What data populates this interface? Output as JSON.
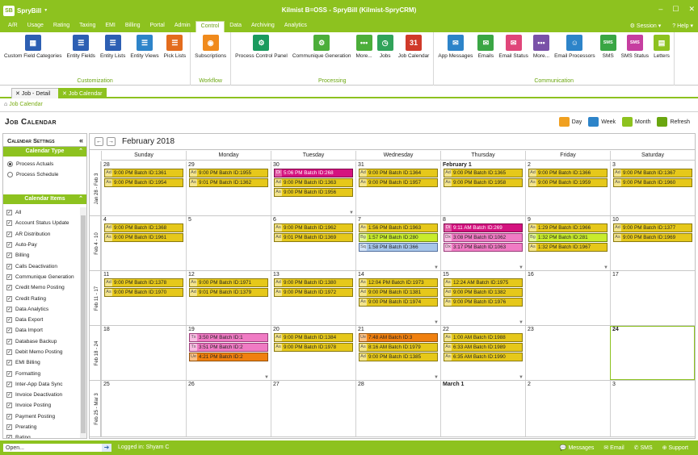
{
  "app": {
    "logo": "SpryBill",
    "logo_mark": "SB",
    "dropdown": "▼",
    "title": "Kilmist B=OSS - SpryBill (Kilmist-SpryCRM)",
    "win_min": "–",
    "win_max": "☐",
    "win_close": "✕"
  },
  "menu": {
    "items": [
      "A/R",
      "Usage",
      "Rating",
      "Taxing",
      "EMI",
      "Billing",
      "Portal",
      "Admin",
      "Control",
      "Data",
      "Archiving",
      "Analytics"
    ],
    "active": "Control",
    "session": "Session",
    "help": "Help"
  },
  "ribbon": {
    "groups": [
      {
        "label": "Customization",
        "buttons": [
          {
            "label": "Custom Field Categories",
            "icon": "grid-icon",
            "color": "#2d5fb3"
          },
          {
            "label": "Entity Fields",
            "icon": "list-icon",
            "color": "#2d5fb3"
          },
          {
            "label": "Entity Lists",
            "icon": "list-icon",
            "color": "#2d5fb3"
          },
          {
            "label": "Entity Views",
            "icon": "list-icon",
            "color": "#2d84c9"
          },
          {
            "label": "Pick Lists",
            "icon": "list-icon",
            "color": "#e36c1d"
          }
        ]
      },
      {
        "label": "Workflow",
        "buttons": [
          {
            "label": "Subscriptions",
            "icon": "rss-icon",
            "color": "#f08a1c"
          }
        ]
      },
      {
        "label": "Processing",
        "buttons": [
          {
            "label": "Process Control Panel",
            "icon": "gear-icon",
            "color": "#1a9a5e"
          },
          {
            "label": "Communique Generation",
            "icon": "gear-icon",
            "color": "#4cae3a"
          },
          {
            "label": "More...",
            "icon": "more-icon",
            "color": "#4cae3a"
          },
          {
            "label": "Jobs",
            "icon": "clock-icon",
            "color": "#31a35a"
          },
          {
            "label": "Job Calendar",
            "icon": "calendar-icon",
            "color": "#d03a2a"
          }
        ]
      },
      {
        "label": "Communication",
        "buttons": [
          {
            "label": "App Messages",
            "icon": "chat-icon",
            "color": "#2d84c9"
          },
          {
            "label": "Emails",
            "icon": "mail-icon",
            "color": "#3aa644"
          },
          {
            "label": "Email Status",
            "icon": "mail-icon",
            "color": "#e0467a"
          },
          {
            "label": "More...",
            "icon": "more-icon",
            "color": "#7a52a8"
          },
          {
            "label": "Email Processors",
            "icon": "people-icon",
            "color": "#2d84c9"
          },
          {
            "label": "SMS",
            "icon": "sms-icon",
            "color": "#3aa644"
          },
          {
            "label": "SMS Status",
            "icon": "sms-icon",
            "color": "#c63ea0"
          },
          {
            "label": "Letters",
            "icon": "doc-icon",
            "color": "#8dc21f"
          }
        ]
      }
    ]
  },
  "tabs": [
    {
      "label": "Job - Detail",
      "active": false
    },
    {
      "label": "Job Calendar",
      "active": true
    }
  ],
  "breadcrumb": "Job Calendar",
  "page_title": "Job Calendar",
  "views": [
    {
      "label": "Day",
      "color": "#f0a020"
    },
    {
      "label": "Week",
      "color": "#2d84c9"
    },
    {
      "label": "Month",
      "color": "#8dc21f"
    },
    {
      "label": "Refresh",
      "color": "#6aa60f"
    }
  ],
  "sidebar": {
    "title": "Calendar Settings",
    "type_title": "Calendar Type",
    "types": [
      {
        "label": "Process Actuals",
        "checked": true
      },
      {
        "label": "Process Schedule",
        "checked": false
      }
    ],
    "items_title": "Calendar Items",
    "items": [
      "All",
      "Account Status Update",
      "AR Distribution",
      "Auto-Pay",
      "Billing",
      "Calls Deactivation",
      "Communique Generation",
      "Credit Memo Posting",
      "Credit Rating",
      "Data Analytics",
      "Data Export",
      "Data Import",
      "Database Backup",
      "Debit Memo Posting",
      "EMI Billing",
      "Formatting",
      "Inter-App Data Sync",
      "Invoice Deactivation",
      "Invoice Posting",
      "Payment Posting",
      "Prerating",
      "Rating"
    ]
  },
  "calendar": {
    "month": "February 2018",
    "dows": [
      "Sunday",
      "Monday",
      "Tuesday",
      "Wednesday",
      "Thursday",
      "Friday",
      "Saturday"
    ],
    "weeks": [
      {
        "label": "Jan 28 - Feb 3",
        "days": [
          {
            "num": "28",
            "events": [
              {
                "tag": "Ad",
                "text": "9:00 PM Batch ID:1361",
                "c": "y"
              },
              {
                "tag": "As",
                "text": "9:00 PM Batch ID:1954",
                "c": "y"
              }
            ]
          },
          {
            "num": "29",
            "events": [
              {
                "tag": "Ad",
                "text": "9:00 PM Batch ID:1955",
                "c": "y"
              },
              {
                "tag": "As",
                "text": "9:01 PM Batch ID:1362",
                "c": "y"
              }
            ]
          },
          {
            "num": "30",
            "more": true,
            "events": [
              {
                "tag": "Di",
                "text": "5:06 PM Batch ID:268",
                "c": "mag"
              },
              {
                "tag": "Ad",
                "text": "9:00 PM Batch ID:1363",
                "c": "y"
              },
              {
                "tag": "As",
                "text": "9:00 PM Batch ID:1956",
                "c": "y"
              }
            ]
          },
          {
            "num": "31",
            "events": [
              {
                "tag": "Ad",
                "text": "9:00 PM Batch ID:1364",
                "c": "y"
              },
              {
                "tag": "As",
                "text": "9:00 PM Batch ID:1957",
                "c": "y"
              }
            ]
          },
          {
            "num": "February 1",
            "bold": true,
            "events": [
              {
                "tag": "Ad",
                "text": "9:00 PM Batch ID:1365",
                "c": "y"
              },
              {
                "tag": "As",
                "text": "9:00 PM Batch ID:1958",
                "c": "y"
              }
            ]
          },
          {
            "num": "2",
            "events": [
              {
                "tag": "Ad",
                "text": "9:00 PM Batch ID:1366",
                "c": "y"
              },
              {
                "tag": "As",
                "text": "9:00 PM Batch ID:1959",
                "c": "y"
              }
            ]
          },
          {
            "num": "3",
            "events": [
              {
                "tag": "Ad",
                "text": "9:00 PM Batch ID:1367",
                "c": "y"
              },
              {
                "tag": "As",
                "text": "9:00 PM Batch ID:1960",
                "c": "y"
              }
            ]
          }
        ]
      },
      {
        "label": "Feb 4 - 10",
        "days": [
          {
            "num": "4",
            "events": [
              {
                "tag": "Ad",
                "text": "9:00 PM Batch ID:1368",
                "c": "y"
              },
              {
                "tag": "As",
                "text": "9:00 PM Batch ID:1961",
                "c": "y"
              }
            ]
          },
          {
            "num": "5",
            "events": []
          },
          {
            "num": "6",
            "events": [
              {
                "tag": "As",
                "text": "9:00 PM Batch ID:1962",
                "c": "y"
              },
              {
                "tag": "Ad",
                "text": "9:01 PM Batch ID:1369",
                "c": "y"
              }
            ]
          },
          {
            "num": "7",
            "more": true,
            "events": [
              {
                "tag": "As",
                "text": "1:56 PM Batch ID:1963",
                "c": "y"
              },
              {
                "tag": "Bg",
                "text": "1:57 PM Batch ID:280",
                "c": "lime"
              },
              {
                "tag": "Sq",
                "text": "1:58 PM Batch ID:366",
                "c": "blue"
              }
            ]
          },
          {
            "num": "8",
            "more": true,
            "events": [
              {
                "tag": "Di",
                "text": "9:11 AM Batch ID:269",
                "c": "mag"
              },
              {
                "tag": "Dx",
                "text": "3:08 PM Batch ID:1062",
                "c": "pink"
              },
              {
                "tag": "Dx",
                "text": "3:17 PM Batch ID:1063",
                "c": "pink"
              }
            ]
          },
          {
            "num": "9",
            "more": true,
            "events": [
              {
                "tag": "As",
                "text": "1:29 PM Batch ID:1966",
                "c": "y"
              },
              {
                "tag": "Bg",
                "text": "1:32 PM Batch ID:281",
                "c": "lime"
              },
              {
                "tag": "As",
                "text": "1:32 PM Batch ID:1967",
                "c": "y"
              }
            ]
          },
          {
            "num": "10",
            "events": [
              {
                "tag": "Ad",
                "text": "9:00 PM Batch ID:1377",
                "c": "y"
              },
              {
                "tag": "As",
                "text": "9:00 PM Batch ID:1969",
                "c": "y"
              }
            ]
          }
        ]
      },
      {
        "label": "Feb 11 - 17",
        "days": [
          {
            "num": "11",
            "events": [
              {
                "tag": "Ad",
                "text": "9:00 PM Batch ID:1378",
                "c": "y"
              },
              {
                "tag": "As",
                "text": "9:00 PM Batch ID:1970",
                "c": "y"
              }
            ]
          },
          {
            "num": "12",
            "events": [
              {
                "tag": "As",
                "text": "9:00 PM Batch ID:1971",
                "c": "y"
              },
              {
                "tag": "Ad",
                "text": "9:01 PM Batch ID:1379",
                "c": "y"
              }
            ]
          },
          {
            "num": "13",
            "events": [
              {
                "tag": "Ad",
                "text": "9:00 PM Batch ID:1380",
                "c": "y"
              },
              {
                "tag": "As",
                "text": "9:00 PM Batch ID:1972",
                "c": "y"
              }
            ]
          },
          {
            "num": "14",
            "more": true,
            "events": [
              {
                "tag": "As",
                "text": "12:04 PM Batch ID:1973",
                "c": "y"
              },
              {
                "tag": "Ad",
                "text": "9:00 PM Batch ID:1381",
                "c": "y"
              },
              {
                "tag": "As",
                "text": "9:00 PM Batch ID:1974",
                "c": "y"
              }
            ]
          },
          {
            "num": "15",
            "more": true,
            "events": [
              {
                "tag": "As",
                "text": "12:24 AM Batch ID:1975",
                "c": "y"
              },
              {
                "tag": "Ad",
                "text": "9:00 PM Batch ID:1382",
                "c": "y"
              },
              {
                "tag": "As",
                "text": "9:00 PM Batch ID:1976",
                "c": "y"
              }
            ]
          },
          {
            "num": "16",
            "events": []
          },
          {
            "num": "17",
            "events": []
          }
        ]
      },
      {
        "label": "Feb 18 - 24",
        "days": [
          {
            "num": "18",
            "events": []
          },
          {
            "num": "19",
            "more": true,
            "events": [
              {
                "tag": "Tx",
                "text": "3:50 PM Batch ID:1",
                "c": "pink"
              },
              {
                "tag": "Tx",
                "text": "3:51 PM Batch ID:2",
                "c": "pink"
              },
              {
                "tag": "Ue",
                "text": "4:21 PM Batch ID:2",
                "c": "orange"
              }
            ]
          },
          {
            "num": "20",
            "events": [
              {
                "tag": "Ad",
                "text": "9:00 PM Batch ID:1384",
                "c": "y"
              },
              {
                "tag": "As",
                "text": "9:00 PM Batch ID:1978",
                "c": "y"
              }
            ]
          },
          {
            "num": "21",
            "more": true,
            "events": [
              {
                "tag": "Ue",
                "text": "7:48 AM Batch ID:3",
                "c": "orange"
              },
              {
                "tag": "As",
                "text": "8:16 AM Batch ID:1979",
                "c": "y"
              },
              {
                "tag": "Ad",
                "text": "9:00 PM Batch ID:1385",
                "c": "y"
              }
            ]
          },
          {
            "num": "22",
            "more": true,
            "events": [
              {
                "tag": "As",
                "text": "1:00 AM Batch ID:1988",
                "c": "y"
              },
              {
                "tag": "As",
                "text": "6:33 AM Batch ID:1989",
                "c": "y"
              },
              {
                "tag": "As",
                "text": "6:35 AM Batch ID:1990",
                "c": "y"
              }
            ]
          },
          {
            "num": "23",
            "events": []
          },
          {
            "num": "24",
            "bold": true,
            "today": true,
            "events": []
          }
        ]
      },
      {
        "label": "Feb 25 - Mar 3",
        "days": [
          {
            "num": "25",
            "events": []
          },
          {
            "num": "26",
            "events": []
          },
          {
            "num": "27",
            "events": []
          },
          {
            "num": "28",
            "events": []
          },
          {
            "num": "March 1",
            "bold": true,
            "events": []
          },
          {
            "num": "2",
            "events": []
          },
          {
            "num": "3",
            "events": []
          }
        ]
      }
    ]
  },
  "status": {
    "open_placeholder": "Open...",
    "logged_in": "Logged in:  Shyam C",
    "links": [
      "Messages",
      "Email",
      "SMS",
      "Support"
    ]
  }
}
